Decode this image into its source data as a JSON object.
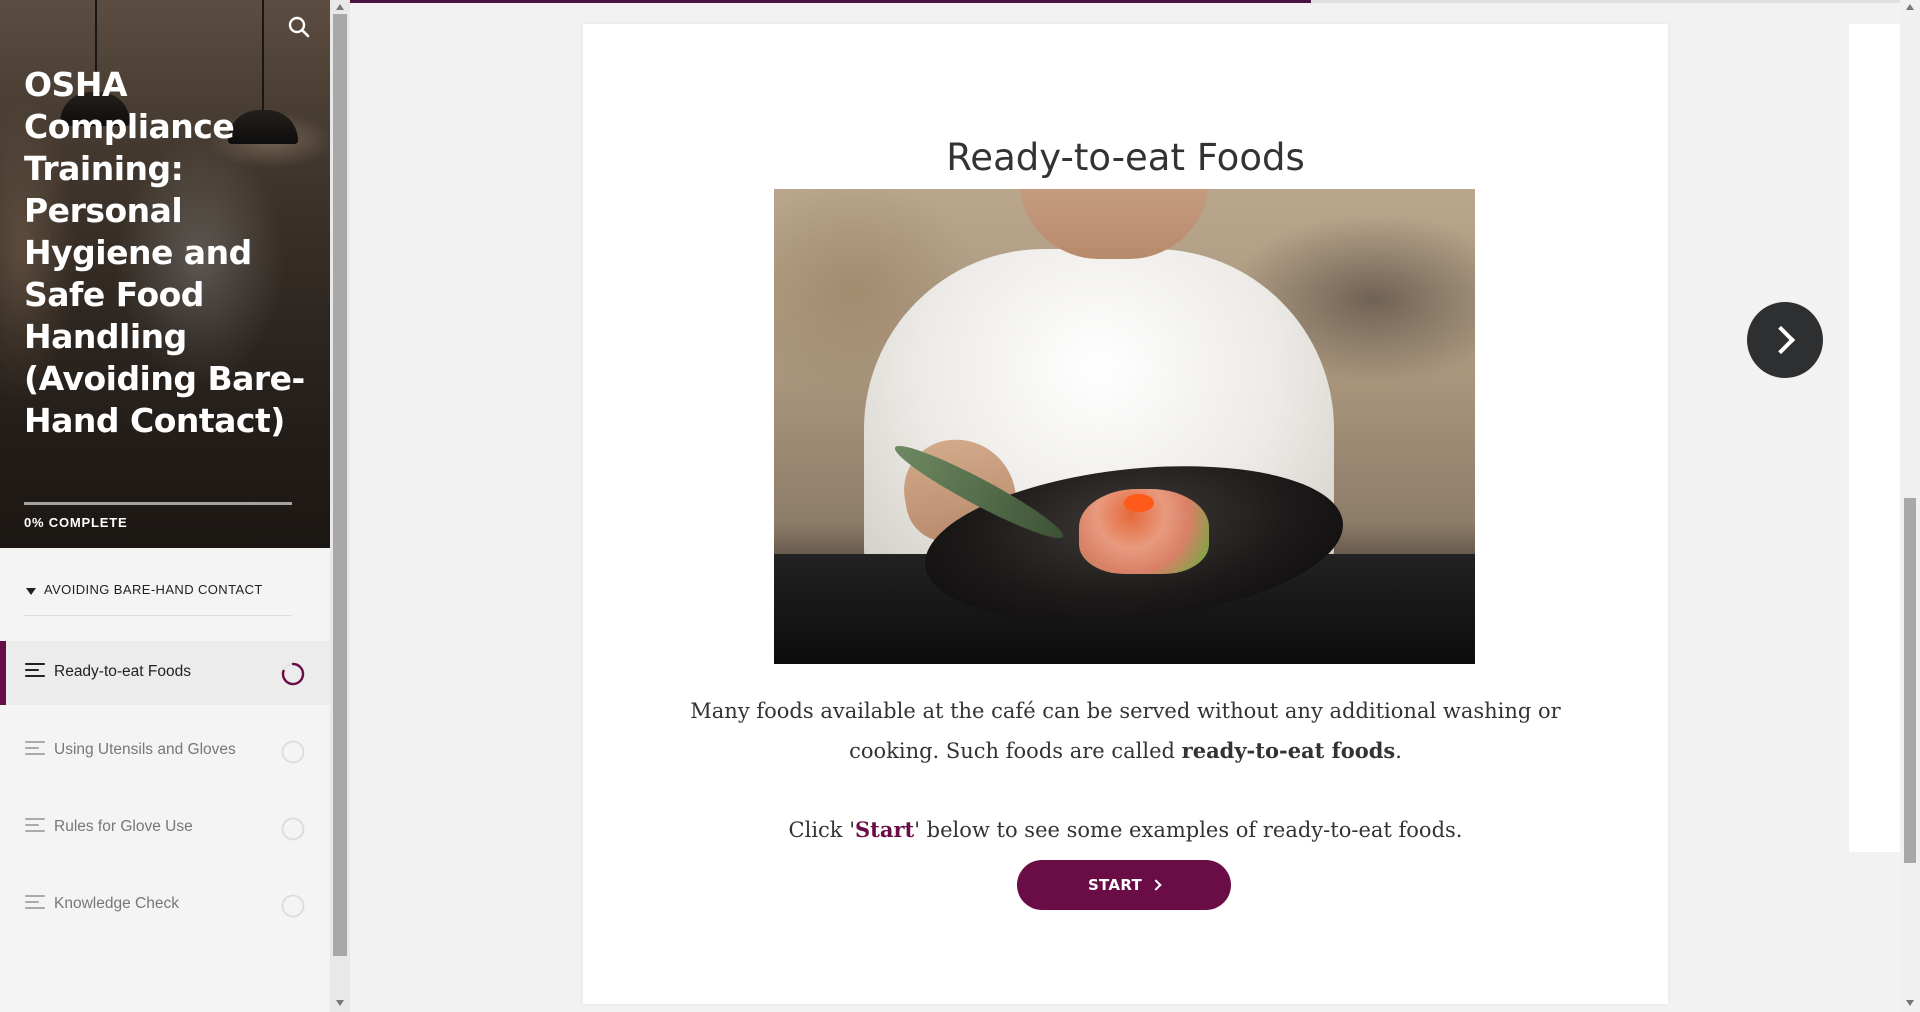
{
  "course": {
    "title": "OSHA Compliance Training: Personal Hygiene and Safe Food Handling (Avoiding Bare-Hand Contact)",
    "progress_label": "0% COMPLETE",
    "progress_fraction": 0
  },
  "icons": {
    "search": "search-icon",
    "lesson": "lesson-text-icon",
    "status_in_progress": "progress-ring-icon",
    "status_not_started": "empty-circle-icon",
    "next": "chevron-right-icon",
    "caret": "caret-down-icon"
  },
  "sidebar": {
    "section_label": "AVOIDING BARE-HAND CONTACT",
    "lessons": [
      {
        "label": "Ready-to-eat Foods",
        "status": "in-progress",
        "active": true
      },
      {
        "label": "Using Utensils and Gloves",
        "status": "not-started",
        "active": false
      },
      {
        "label": "Rules for Glove Use",
        "status": "not-started",
        "active": false
      },
      {
        "label": "Knowledge Check",
        "status": "not-started",
        "active": false
      }
    ]
  },
  "main": {
    "lesson_title": "Ready-to-eat Foods",
    "paragraph1_pre": "Many foods available at the café can be served without any additional washing or cooking. Such foods are called ",
    "paragraph1_bold": "ready-to-eat foods",
    "paragraph1_post": ".",
    "paragraph2_pre": "Click '",
    "paragraph2_highlight": "Start",
    "paragraph2_post": "' below to see some examples of ready-to-eat foods.",
    "start_button_label": "START",
    "top_progress_fraction": 0.62
  },
  "colors": {
    "brand": "#6a0d47",
    "next_button": "#2d2f31",
    "top_progress": "#4a1440"
  }
}
